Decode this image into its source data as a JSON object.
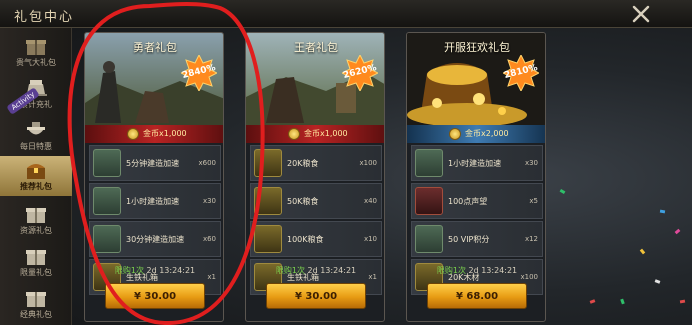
{
  "header": {
    "title": "礼包中心"
  },
  "sidebar": {
    "activity_tag": "Activity",
    "items": [
      {
        "label": "贵气大礼包",
        "icon": "gift-box-icon",
        "active": false,
        "faded": true
      },
      {
        "label": "累计充礼",
        "icon": "sedan-icon",
        "active": false,
        "faded": false
      },
      {
        "label": "每日特惠",
        "icon": "pot-icon",
        "active": false,
        "faded": false
      },
      {
        "label": "推荐礼包",
        "icon": "treasure-chest-icon",
        "active": true,
        "faded": false
      },
      {
        "label": "资源礼包",
        "icon": "gift-box-icon",
        "active": false,
        "faded": false
      },
      {
        "label": "限量礼包",
        "icon": "gift-box-icon",
        "active": false,
        "faded": false
      },
      {
        "label": "经典礼包",
        "icon": "gift-box-icon",
        "active": false,
        "faded": false
      }
    ]
  },
  "cards": [
    {
      "title": "勇者礼包",
      "discount": "2840%",
      "ribbon": "red",
      "coins": "金币x1,000",
      "items": [
        {
          "name": "5分钟建造加速",
          "qty": "x600",
          "icon": "hammer-icon",
          "tone": ""
        },
        {
          "name": "1小时建造加速",
          "qty": "x30",
          "icon": "hammer-icon",
          "tone": ""
        },
        {
          "name": "30分钟建造加速",
          "qty": "x60",
          "icon": "hammer-icon",
          "tone": ""
        },
        {
          "name": "生铁礼箱",
          "qty": "x1",
          "icon": "iron-crate-icon",
          "tone": "gold"
        }
      ],
      "limit": "限购1次",
      "time": "2d 13:24:21",
      "price": "¥ 30.00"
    },
    {
      "title": "王者礼包",
      "discount": "2620%",
      "ribbon": "red",
      "coins": "金币x1,000",
      "items": [
        {
          "name": "20K粮食",
          "qty": "x100",
          "icon": "grain-icon",
          "tone": "gold"
        },
        {
          "name": "50K粮食",
          "qty": "x40",
          "icon": "grain-icon",
          "tone": "gold"
        },
        {
          "name": "100K粮食",
          "qty": "x10",
          "icon": "grain-icon",
          "tone": "gold"
        },
        {
          "name": "生铁礼箱",
          "qty": "x1",
          "icon": "iron-crate-icon",
          "tone": "gold"
        }
      ],
      "limit": "限购1次",
      "time": "2d 13:24:21",
      "price": "¥ 30.00"
    },
    {
      "title": "开服狂欢礼包",
      "discount": "2810%",
      "ribbon": "blue",
      "coins": "金币x2,000",
      "items": [
        {
          "name": "1小时建造加速",
          "qty": "x30",
          "icon": "hammer-icon",
          "tone": ""
        },
        {
          "name": "100点声望",
          "qty": "x5",
          "icon": "crown-icon",
          "tone": "red"
        },
        {
          "name": "50 VIP积分",
          "qty": "x12",
          "icon": "vip-icon",
          "tone": ""
        },
        {
          "name": "20K木材",
          "qty": "x100",
          "icon": "wood-icon",
          "tone": "gold"
        }
      ],
      "limit": "限购1次",
      "time": "2d 13:24:21",
      "price": "¥ 68.00"
    }
  ],
  "colors": {
    "accent_gold": "#e79b13",
    "ribbon_red": "#b82323",
    "ribbon_blue": "#3e7bb2",
    "limit_green": "#7bd24d"
  }
}
